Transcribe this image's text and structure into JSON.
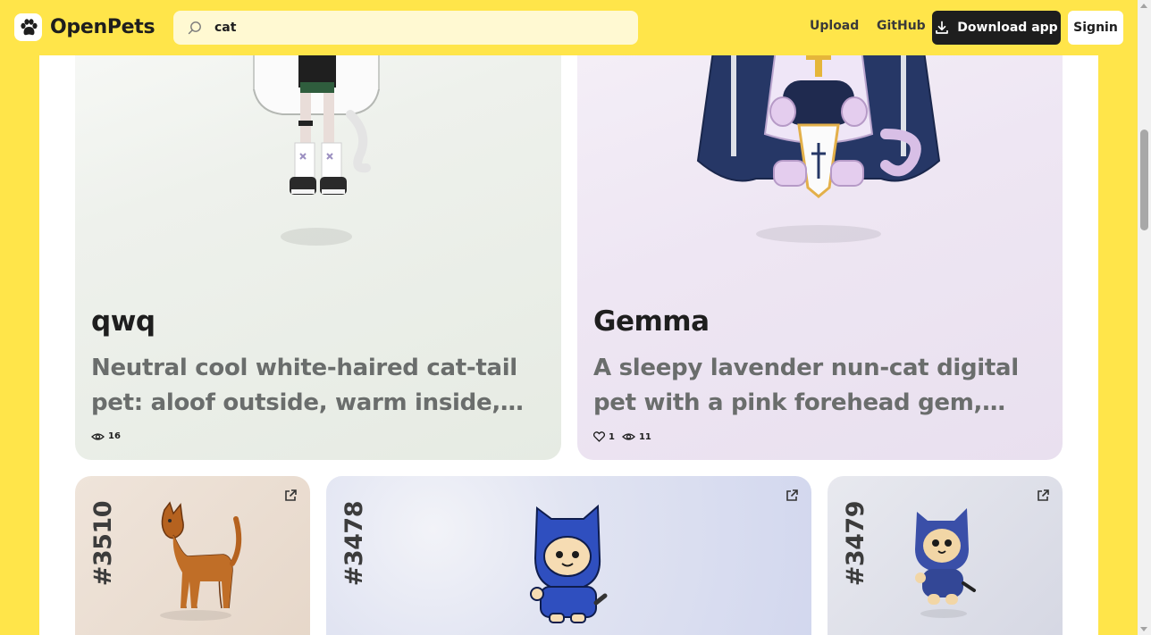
{
  "header": {
    "brand": "OpenPets",
    "search": {
      "value": "cat",
      "placeholder": "Search pets"
    },
    "nav": {
      "upload": "Upload",
      "github": "GitHub"
    },
    "download_label": "Download app",
    "signin_label": "Signin"
  },
  "featured": [
    {
      "title": "qwq",
      "description": "Neutral cool white-haired cat-tail pet: aloof outside, warm inside, cute companion.",
      "views": "16"
    },
    {
      "title": "Gemma",
      "description": "A sleepy lavender nun-cat digital pet with a pink forehead gem, navy veil and golden cross.",
      "likes": "1",
      "views": "11"
    }
  ],
  "grid": [
    {
      "number": "#3510"
    },
    {
      "number": "#3478"
    },
    {
      "number": "#3479"
    }
  ],
  "colors": {
    "background": "#ffe54a",
    "search_bg": "#fff9d2",
    "dark_button": "#1e1e1e"
  },
  "icons": {
    "brand": "paw-icon",
    "search": "search-icon",
    "download": "download-icon",
    "external": "external-link-icon",
    "heart": "heart-icon",
    "eye": "eye-icon"
  }
}
